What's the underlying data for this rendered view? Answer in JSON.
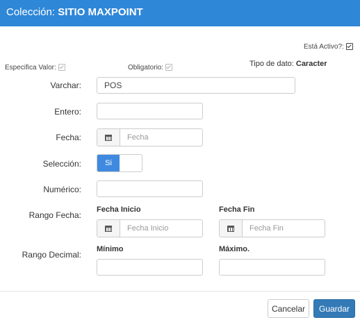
{
  "header": {
    "prefix": "Colección:",
    "name": "SITIO MAXPOINT"
  },
  "status": {
    "activo_label": "Está Activo?:",
    "activo_checked": true
  },
  "especifica": {
    "label": "Especifica Valor:",
    "checked": true
  },
  "obligatorio": {
    "label": "Obligatorio:",
    "checked": true
  },
  "tipo": {
    "label": "Tipo de dato:",
    "value": "Caracter"
  },
  "fields": {
    "varchar": {
      "label": "Varchar:",
      "value": "POS"
    },
    "entero": {
      "label": "Entero:",
      "value": ""
    },
    "fecha": {
      "label": "Fecha:",
      "placeholder": "Fecha"
    },
    "seleccion": {
      "label": "Selección:",
      "on_label": "Si"
    },
    "numerico": {
      "label": "Numérico:",
      "value": ""
    },
    "rango_fecha": {
      "label": "Rango Fecha:",
      "inicio_title": "Fecha Inicio",
      "inicio_placeholder": "Fecha Inicio",
      "fin_title": "Fecha Fin",
      "fin_placeholder": "Fecha Fin"
    },
    "rango_decimal": {
      "label": "Rango Decimal:",
      "minimo_title": "Mínimo",
      "maximo_title": "Máximo.",
      "minimo_value": "",
      "maximo_value": ""
    }
  },
  "footer": {
    "cancel_label": "Cancelar",
    "save_label": "Guardar"
  },
  "icons": {
    "calendar": "calendar-icon",
    "check": "checkbox-checked"
  },
  "colors": {
    "header_bg": "#2f87d8",
    "primary": "#337ab7",
    "toggle_on": "#3f8ae0"
  }
}
